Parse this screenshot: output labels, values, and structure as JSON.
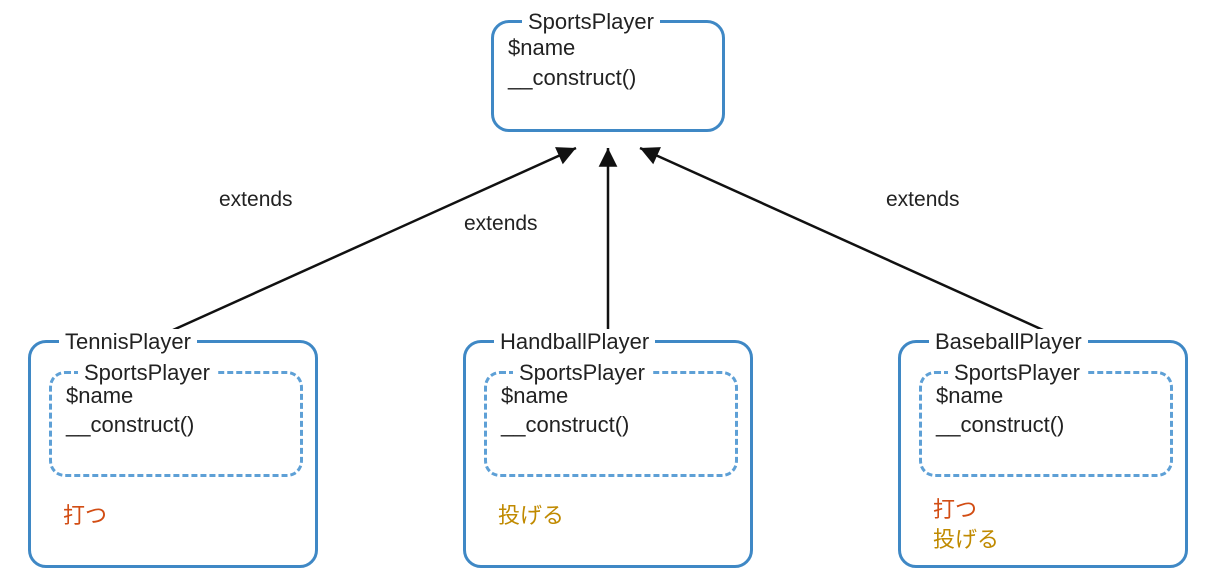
{
  "parent": {
    "name": "SportsPlayer",
    "prop": "$name",
    "ctor": "__construct()"
  },
  "edgeLabel": "extends",
  "children": [
    {
      "name": "TennisPlayer",
      "inheritedFrom": "SportsPlayer",
      "prop": "$name",
      "ctor": "__construct()",
      "methods": [
        {
          "text": "打つ",
          "color": "orange"
        }
      ]
    },
    {
      "name": "HandballPlayer",
      "inheritedFrom": "SportsPlayer",
      "prop": "$name",
      "ctor": "__construct()",
      "methods": [
        {
          "text": "投げる",
          "color": "olive"
        }
      ]
    },
    {
      "name": "BaseballPlayer",
      "inheritedFrom": "SportsPlayer",
      "prop": "$name",
      "ctor": "__construct()",
      "methods": [
        {
          "text": "打つ",
          "color": "orange"
        },
        {
          "text": "投げる",
          "color": "olive"
        }
      ]
    }
  ]
}
